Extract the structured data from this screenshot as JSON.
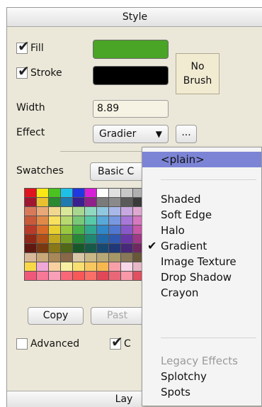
{
  "panel": {
    "title": "Style"
  },
  "fill": {
    "label": "Fill",
    "checked": true,
    "color": "#4aa526"
  },
  "stroke": {
    "label": "Stroke",
    "checked": true,
    "color": "#000000"
  },
  "no_brush": {
    "line1": "No",
    "line2": "Brush"
  },
  "width": {
    "label": "Width",
    "value": "8.89"
  },
  "effect": {
    "label": "Effect",
    "selected": "Gradier",
    "more_label": "..."
  },
  "swatches": {
    "label": "Swatches",
    "set_name": "Basic C"
  },
  "buttons": {
    "copy": "Copy",
    "paste": "Past"
  },
  "advanced": {
    "label": "Advanced",
    "checked": false,
    "second_label": "C",
    "second_checked": true
  },
  "bottom_panel": {
    "title": "Lay"
  },
  "effect_menu": {
    "plain": "<plain>",
    "items": [
      "Shaded",
      "Soft Edge",
      "Halo",
      "Gradient",
      "Image Texture",
      "Drop Shadow",
      "Crayon"
    ],
    "checked_item": "Gradient",
    "legacy_header": "Legacy Effects",
    "legacy_items": [
      "Splotchy",
      "Spots"
    ]
  },
  "swatch_colors": [
    [
      "#e0141e",
      "#f7e816",
      "#4ac220",
      "#1fc0e8",
      "#1f38e0",
      "#d81fd8",
      "#ffffff",
      "#e0e0e0",
      "#c8c8c8",
      "#b0b0b0",
      "#999999"
    ],
    [
      "#a01530",
      "#e8c030",
      "#2a8a30",
      "#1f7ab0",
      "#3a1f90",
      "#90208a",
      "#7a7a7a",
      "#8a8a8a",
      "#5a5a5a",
      "#3a3a3a",
      "#000000"
    ],
    [
      "#d87a5a",
      "#e8a878",
      "#f0d890",
      "#d8e898",
      "#a8d890",
      "#90d8c0",
      "#90c8e0",
      "#a8b8e8",
      "#c8a8e0",
      "#e0a8d0",
      "#f0a8b0"
    ],
    [
      "#c85a3a",
      "#e08a48",
      "#f8e060",
      "#b8d870",
      "#78c878",
      "#58c8a8",
      "#58a8d8",
      "#7898e0",
      "#a878d8",
      "#d878c0",
      "#e87890"
    ],
    [
      "#b83a28",
      "#d86a28",
      "#e8d030",
      "#98c840",
      "#48b048",
      "#30a890",
      "#3088c8",
      "#5078d0",
      "#8858c8",
      "#c858a8",
      "#d85878"
    ],
    [
      "#902818",
      "#b05018",
      "#c0a820",
      "#78a028",
      "#288838",
      "#208870",
      "#2068a8",
      "#3058b0",
      "#6838a8",
      "#a03888",
      "#b03858"
    ],
    [
      "#601810",
      "#783810",
      "#887818",
      "#506818",
      "#185828",
      "#185848",
      "#184870",
      "#203878",
      "#482878",
      "#702860",
      "#782838"
    ],
    [
      "#d8b898",
      "#c8a878",
      "#a88858",
      "#886848",
      "#d8c8a8",
      "#c8b888",
      "#b8a878",
      "#a89868",
      "#887858",
      "#685838",
      "#483828"
    ],
    [
      "#f8d848",
      "#f0a8d8",
      "#f8d0a0",
      "#f8f0a0",
      "#f8e070",
      "#f8c860",
      "#f8b850",
      "#f8a0a8",
      "#f8d8e8",
      "#e8b8c8",
      "#f0c8a0"
    ],
    [
      "#f0587a",
      "#f87898",
      "#f8a0b8",
      "#f86878",
      "#f85858",
      "#f87068",
      "#e04858",
      "#e86878",
      "#f898a8",
      "#e05060",
      "#c83848"
    ]
  ]
}
